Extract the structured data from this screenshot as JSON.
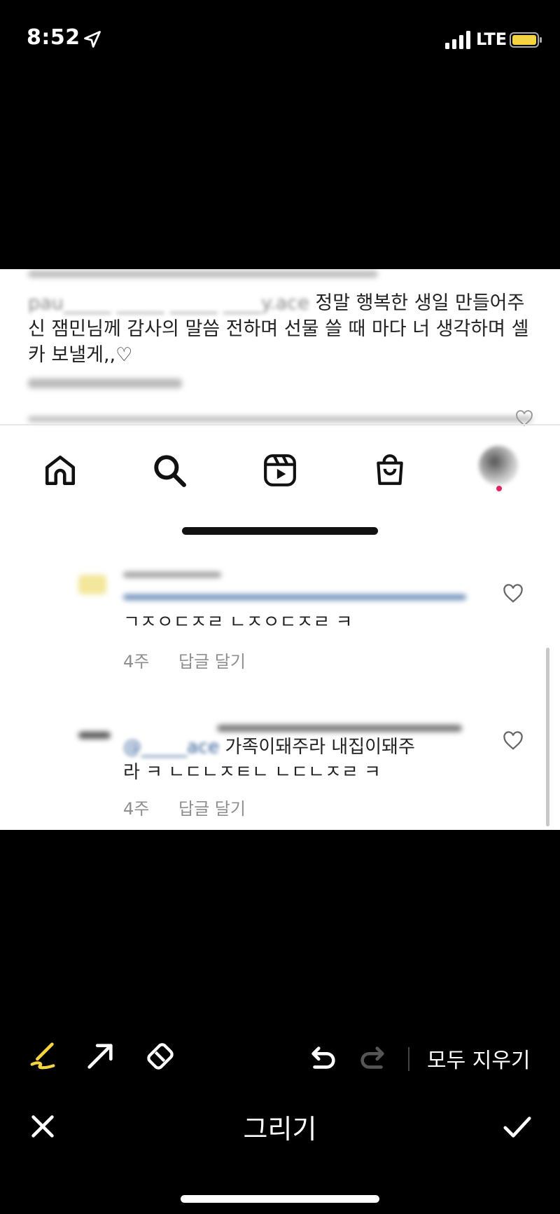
{
  "status_bar": {
    "time": "8:52",
    "network": "LTE",
    "battery_color": "#f5d442"
  },
  "caption": {
    "visible_text": "정말 행복한 생일 만들어주신 잼민님께 감사의 말씀 전하며 선물 쓸 때 마다 너 생각하며 셀카 보낼게,,♡"
  },
  "comments": [
    {
      "text": "ㄱㅈㅇㄷㅈㄹ ㄴㅈㅇㄷㅈㄹ ㅋ",
      "age": "4주",
      "reply": "답글 달기"
    },
    {
      "text_line1": "가족이돼주라 내집이돼주",
      "text_line2": "라 ㅋ ㄴㄷㄴㅈㅌㄴ ㄴㄷㄴㅈㄹ ㅋ",
      "age": "4주",
      "reply": "답글 달기"
    }
  ],
  "toolbar": {
    "clear_all": "모두 지우기",
    "title": "그리기",
    "accent": "#f5d442"
  }
}
